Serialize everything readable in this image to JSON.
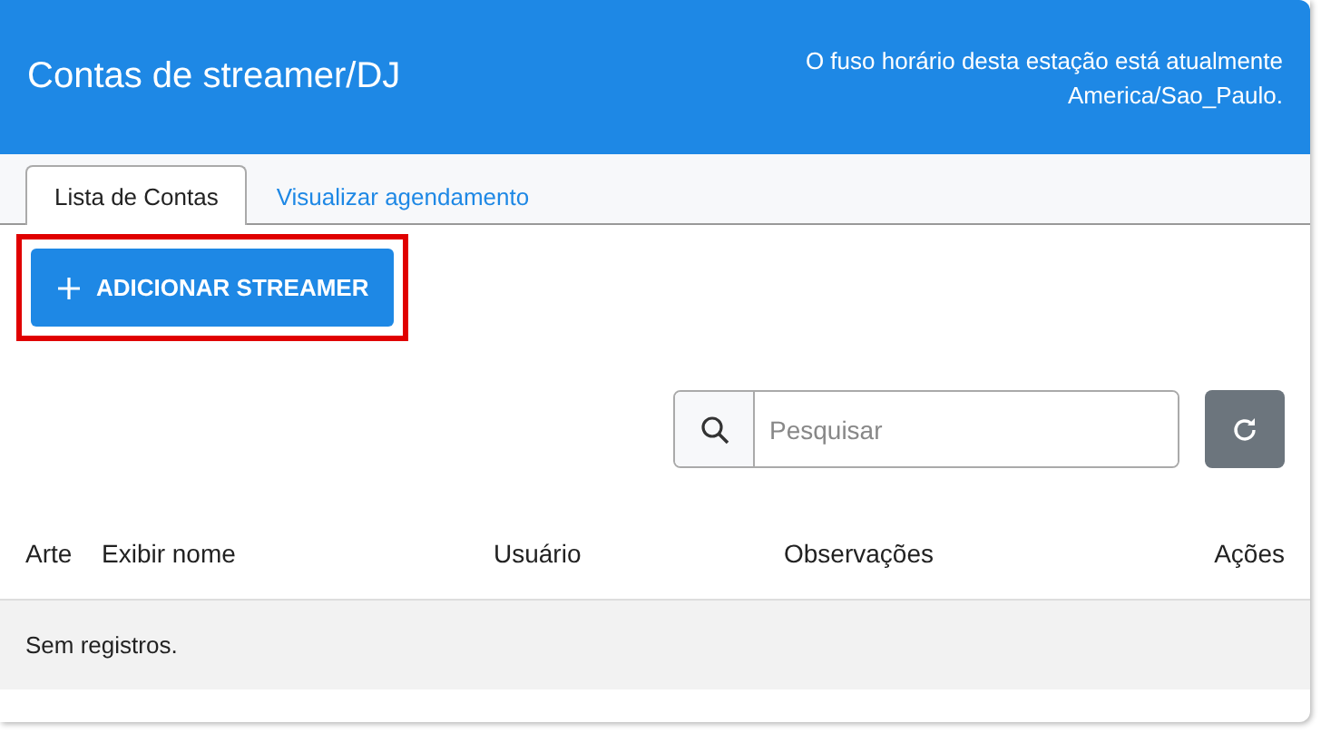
{
  "header": {
    "title": "Contas de streamer/DJ",
    "timezone_note": [
      "O fuso horário desta estação está atualmente",
      "America/Sao_Paulo."
    ]
  },
  "tabs": [
    {
      "label": "Lista de Contas",
      "selected": true
    },
    {
      "label": "Visualizar agendamento",
      "selected": false
    }
  ],
  "add_button": {
    "label": "ADICIONAR STREAMER",
    "highlighted": true
  },
  "search": {
    "placeholder": "Pesquisar"
  },
  "table": {
    "columns": [
      "Arte",
      "Exibir nome",
      "Usuário",
      "Observações",
      "Ações"
    ],
    "empty_message": "Sem registros."
  }
}
